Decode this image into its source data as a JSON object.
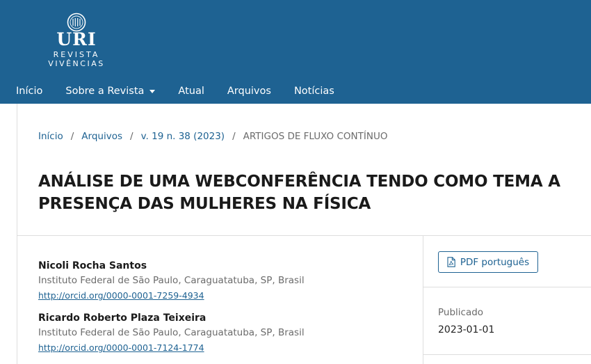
{
  "header": {
    "logo": {
      "main": "URI",
      "line1": "REVISTA",
      "line2": "VIVÊNCIAS"
    },
    "nav": [
      {
        "label": "Início"
      },
      {
        "label": "Sobre a Revista",
        "has_dropdown": true
      },
      {
        "label": "Atual"
      },
      {
        "label": "Arquivos"
      },
      {
        "label": "Notícias"
      }
    ]
  },
  "breadcrumb": {
    "items": [
      "Início",
      "Arquivos",
      "v. 19 n. 38 (2023)"
    ],
    "separator": "/",
    "current": "ARTIGOS DE FLUXO CONTÍNUO"
  },
  "article": {
    "title_line1": "ANÁLISE DE UMA WEBCONFERÊNCIA TENDO COMO TEMA A",
    "title_line2": "PRESENÇA DAS MULHERES NA FÍSICA",
    "authors": [
      {
        "name": "Nicoli Rocha Santos",
        "affiliation": "Instituto Federal de São Paulo, Caraguatatuba, SP, Brasil",
        "orcid": "http://orcid.org/0000-0001-7259-4934"
      },
      {
        "name": "Ricardo Roberto Plaza Teixeira",
        "affiliation": "Instituto Federal de São Paulo, Caraguatatuba, SP, Brasil",
        "orcid": "http://orcid.org/0000-0001-7124-1774"
      }
    ]
  },
  "sidebar": {
    "pdf_label": "PDF português",
    "published_label": "Publicado",
    "published_date": "2023-01-01"
  },
  "colors": {
    "header_bg": "#1e6292",
    "link": "#1e6292"
  }
}
